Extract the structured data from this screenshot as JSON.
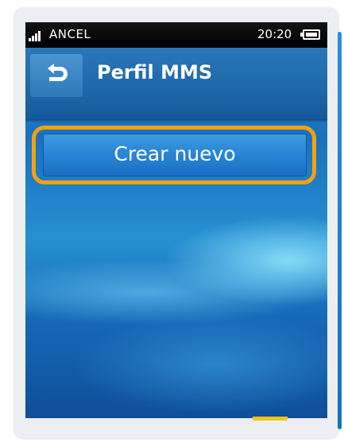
{
  "status_bar": {
    "carrier": "ANCEL",
    "time": "20:20",
    "signal_icon": "signal-bars-icon",
    "battery_icon": "battery-icon"
  },
  "header": {
    "back_icon": "back-arrow-icon",
    "title": "Perfil MMS"
  },
  "main": {
    "create_button_label": "Crear nuevo"
  },
  "colors": {
    "highlight": "#f5a20f",
    "accent_bar": "#2c8fd8",
    "bottom_tab": "#f2c21a"
  }
}
